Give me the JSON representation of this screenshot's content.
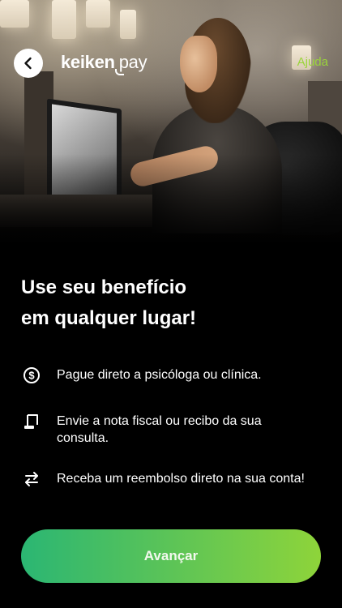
{
  "header": {
    "back_icon": "chevron-left-icon",
    "logo": {
      "brand": "keiken",
      "product": "pay"
    },
    "help_label": "Ajuda"
  },
  "hero": {
    "image": "woman-at-reception-desk-photo"
  },
  "headline": {
    "line1": "Use seu benefício",
    "line2": "em qualquer lugar!"
  },
  "features": [
    {
      "icon": "dollar-coin-icon",
      "text": "Pague direto a psicóloga ou clínica."
    },
    {
      "icon": "receipt-document-icon",
      "text": "Envie a nota fiscal ou recibo da sua consulta."
    },
    {
      "icon": "transfer-arrows-icon",
      "text": "Receba um reembolso direto na sua conta!"
    }
  ],
  "cta": {
    "label": "Avançar"
  },
  "colors": {
    "background": "#000000",
    "accent_green": "#9ad43a",
    "button_gradient_start": "#2bb673",
    "button_gradient_end": "#8ed43a",
    "text": "#ffffff"
  }
}
